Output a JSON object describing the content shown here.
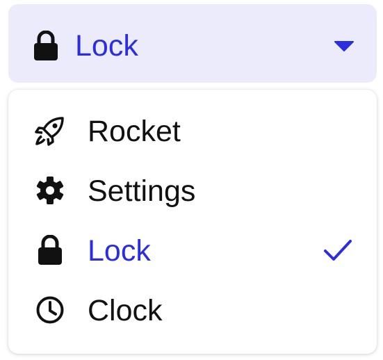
{
  "select": {
    "value_label": "Lock",
    "value_icon": "lock-icon",
    "caret_icon": "caret-down-icon"
  },
  "menu": {
    "items": [
      {
        "label": "Rocket",
        "icon": "rocket-icon",
        "selected": false
      },
      {
        "label": "Settings",
        "icon": "gear-icon",
        "selected": false
      },
      {
        "label": "Lock",
        "icon": "lock-icon",
        "selected": true
      },
      {
        "label": "Clock",
        "icon": "clock-icon",
        "selected": false
      }
    ],
    "check_icon": "checkmark-icon"
  },
  "colors": {
    "accent": "#2b2ee0",
    "trigger_background": "#ebebfc",
    "text": "#111111"
  }
}
